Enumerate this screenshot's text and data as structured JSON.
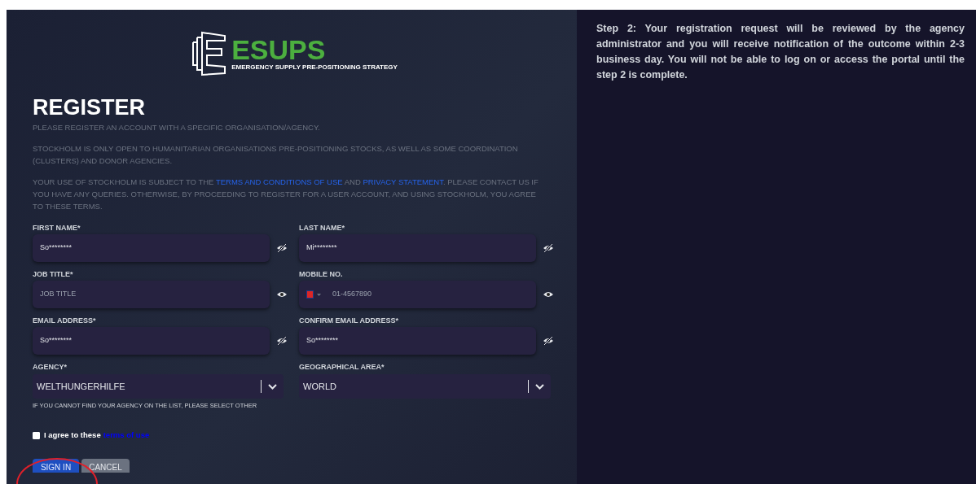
{
  "logo": {
    "name": "ESUPS",
    "tagline": "EMERGENCY SUPPLY PRE-POSITIONING STRATEGY"
  },
  "title": "REGISTER",
  "intro": [
    {
      "parts": [
        {
          "kind": "text",
          "text": "PLEASE REGISTER AN ACCOUNT WITH A SPECIFIC ORGANISATION/AGENCY."
        }
      ]
    },
    {
      "parts": [
        {
          "kind": "text",
          "text": "STOCKHOLM IS ONLY OPEN TO HUMANITARIAN ORGANISATIONS PRE-POSITIONING STOCKS, AS WELL AS SOME COORDINATION (CLUSTERS) AND DONOR AGENCIES."
        }
      ]
    },
    {
      "parts": [
        {
          "kind": "text",
          "text": "YOUR USE OF STOCKHOLM IS SUBJECT TO THE "
        },
        {
          "kind": "link",
          "text": "TERMS AND CONDITIONS OF USE"
        },
        {
          "kind": "text",
          "text": " AND "
        },
        {
          "kind": "link",
          "text": "PRIVACY STATEMENT"
        },
        {
          "kind": "text",
          "text": ". PLEASE CONTACT US IF YOU HAVE ANY QUERIES. OTHERWISE, BY PROCEEDING TO REGISTER FOR A USER ACCOUNT, AND USING STOCKHOLM, YOU AGREE TO THESE TERMS."
        }
      ]
    }
  ],
  "fields": [
    {
      "kind": "text",
      "label": "FIRST NAME*",
      "value": "So********",
      "masked": true
    },
    {
      "kind": "text",
      "label": "LAST NAME*",
      "value": "Mi********",
      "masked": true
    },
    {
      "kind": "text",
      "label": "JOB TITLE*",
      "placeholder": "JOB TITLE",
      "masked": false
    },
    {
      "kind": "phone",
      "label": "MOBILE NO.",
      "placeholder": "01-4567890",
      "masked": false
    },
    {
      "kind": "text",
      "label": "EMAIL ADDRESS*",
      "value": "So********",
      "masked": true
    },
    {
      "kind": "text",
      "label": "CONFIRM EMAIL ADDRESS*",
      "value": "So********",
      "masked": true
    }
  ],
  "selects": [
    {
      "label": "AGENCY*",
      "value": "WELTHUNGERHILFE",
      "hint": "IF YOU CANNOT FIND YOUR AGENCY ON THE LIST, PLEASE SELECT OTHER"
    },
    {
      "label": "GEOGRAPHICAL AREA*",
      "value": "WORLD"
    }
  ],
  "agree": {
    "checked": false,
    "text": "I agree to these",
    "link": "terms of use"
  },
  "buttons": [
    {
      "kind": "primary",
      "label": "SIGN IN"
    },
    {
      "kind": "secondary",
      "label": "CANCEL"
    }
  ],
  "side_note": "Step 2: Your registration request will be reviewed by the agency administrator and you will receive notification of the outcome within 2-3 business day. You will not be able to log on or access the portal until the step 2 is complete."
}
